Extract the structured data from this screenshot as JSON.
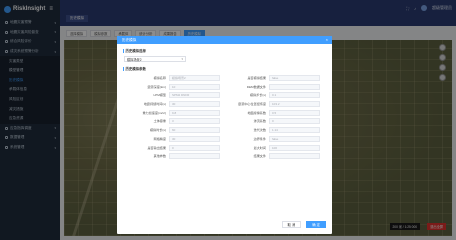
{
  "app": {
    "name": "RiskInsight",
    "menu_icon": "hamburger-icon"
  },
  "sidebar": {
    "items": [
      {
        "label": "地震灾害预警",
        "level": 1
      },
      {
        "label": "地震灾害风险普查",
        "level": 1
      },
      {
        "label": "综合风险评价",
        "level": 1
      },
      {
        "label": "成灾系统预警分析",
        "level": 1
      },
      {
        "label": "灾害类型",
        "level": 2
      },
      {
        "label": "模型管理",
        "level": 2
      },
      {
        "label": "历史模拟",
        "level": 2,
        "active": true
      },
      {
        "label": "承载体信息",
        "level": 2
      },
      {
        "label": "风险区划",
        "level": 2
      },
      {
        "label": "减灾措施",
        "level": 2
      },
      {
        "label": "应急资源",
        "level": 2
      },
      {
        "label": "应急指挥调度",
        "level": 1
      },
      {
        "label": "数据管理",
        "level": 1
      },
      {
        "label": "系统管理",
        "level": 1
      }
    ]
  },
  "topbar": {
    "tab": "历史模拟",
    "user": "超级管理员"
  },
  "toolbar": {
    "buttons": [
      "选择模拟",
      "模拟参数",
      "承载体",
      "统计分析",
      "成果报告",
      "历史模拟"
    ]
  },
  "map": {
    "scale_text": "200 米 / 1:25 000",
    "red_button": "退出全屏"
  },
  "modal": {
    "title": "历史模拟",
    "close": "×",
    "section1": "历史模拟选择",
    "select_value": "模拟场景2",
    "section2": "历史模拟参数",
    "fields": [
      {
        "label": "模拟名称",
        "value": "模拟场景2"
      },
      {
        "label": "是否模拟结果",
        "value": "false"
      },
      {
        "label": "震源深度(km)",
        "value": "10"
      },
      {
        "label": "DEM数据文件",
        "value": ""
      },
      {
        "label": "LPM模型",
        "value": "SPM2 DNFR"
      },
      {
        "label": "模拟步长(s)",
        "value": "0.1"
      },
      {
        "label": "地震持续时间(s)",
        "value": "30"
      },
      {
        "label": "震源中心位置经纬度",
        "value": "103.2"
      },
      {
        "label": "重力加速度(m/s²)",
        "value": "9.8"
      },
      {
        "label": "地面摩擦系数",
        "value": "0.5"
      },
      {
        "label": "土体容重",
        "value": "3"
      },
      {
        "label": "渗流系数",
        "value": "0"
      },
      {
        "label": "模拟时长(s)",
        "value": "60"
      },
      {
        "label": "迭代次数",
        "value": "1.14"
      },
      {
        "label": "网格精度",
        "value": "30"
      },
      {
        "label": "边界条件",
        "value": "false"
      },
      {
        "label": "是否输出结果",
        "value": "0"
      },
      {
        "label": "最大时间",
        "value": "100"
      },
      {
        "label": "其他参数",
        "value": ""
      },
      {
        "label": "结果文件",
        "value": ""
      }
    ],
    "cancel": "取 消",
    "confirm": "确 定"
  },
  "colors": {
    "sidebar": "#1f2d3d",
    "topbar": "#2b3b72",
    "accent": "#409eff",
    "danger": "#e0322f"
  }
}
